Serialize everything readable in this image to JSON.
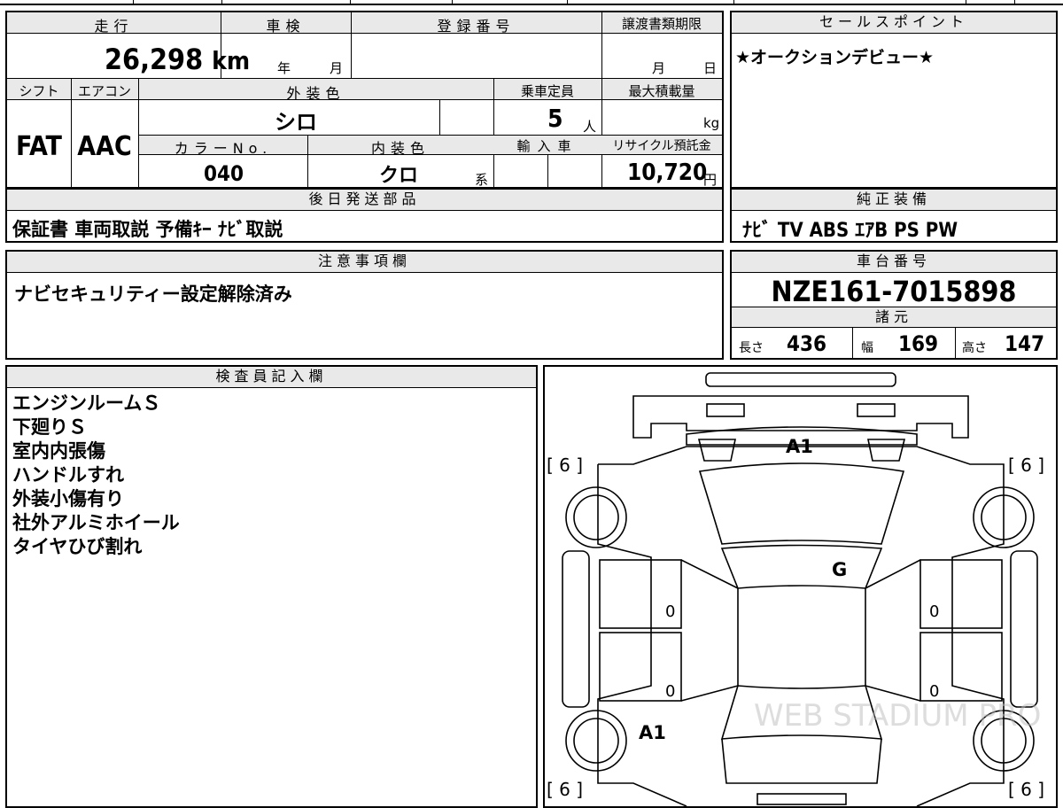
{
  "vehicle": {
    "mileage_label": "走行",
    "mileage": "26,298",
    "mileage_unit": "km",
    "inspection_label": "車検",
    "inspection_year_unit": "年",
    "inspection_month_unit": "月",
    "registration_label": "登録番号",
    "transfer_deadline_label": "譲渡書類期限",
    "transfer_month_unit": "月",
    "transfer_day_unit": "日",
    "shift_label": "シフト",
    "shift": "FAT",
    "aircon_label": "エアコン",
    "aircon": "AAC",
    "exterior_color_label": "外装色",
    "exterior_color": "シロ",
    "capacity_label": "乗車定員",
    "capacity": "5",
    "capacity_unit": "人",
    "max_load_label": "最大積載量",
    "max_load_unit": "kg",
    "color_no_label": "カラーNo.",
    "color_no": "040",
    "interior_color_label": "内装色",
    "interior_color": "クロ",
    "interior_color_suffix": "系",
    "import_label": "輸入車",
    "recycle_label": "リサイクル預託金",
    "recycle_fee": "10,720",
    "recycle_unit": "円"
  },
  "sales_point": {
    "label": "セールスポイント",
    "text": "★オークションデビュー★"
  },
  "later_shipping": {
    "label": "後日発送部品",
    "text": "保証書 車両取説 予備ｷｰ ﾅﾋﾞ取説"
  },
  "genuine_equipment": {
    "label": "純正装備",
    "text": "ﾅﾋﾞ TV ABS ｴｱB PS PW"
  },
  "notes": {
    "label": "注意事項欄",
    "text": "ナビセキュリティー設定解除済み"
  },
  "chassis": {
    "label": "車台番号",
    "number": "NZE161-7015898"
  },
  "specs": {
    "label": "諸元",
    "length_label": "長さ",
    "length": "436",
    "width_label": "幅",
    "width": "169",
    "height_label": "高さ",
    "height": "147"
  },
  "inspector": {
    "label": "検査員記入欄",
    "lines": [
      "エンジンルームＳ",
      "下廻りＳ",
      "室内内張傷",
      "ハンドルすれ",
      "外装小傷有り",
      "社外アルミホイール",
      "タイヤひび割れ"
    ]
  },
  "diagram": {
    "tire_marks": [
      "[ 6 ]",
      "[ 6 ]",
      "[ 6 ]",
      "[ 6 ]"
    ],
    "damage_marks": [
      "A1",
      "G",
      "A1"
    ],
    "zero_marks": [
      "0",
      "0",
      "0",
      "0"
    ],
    "watermark": "WEB STADIUM PRO"
  }
}
